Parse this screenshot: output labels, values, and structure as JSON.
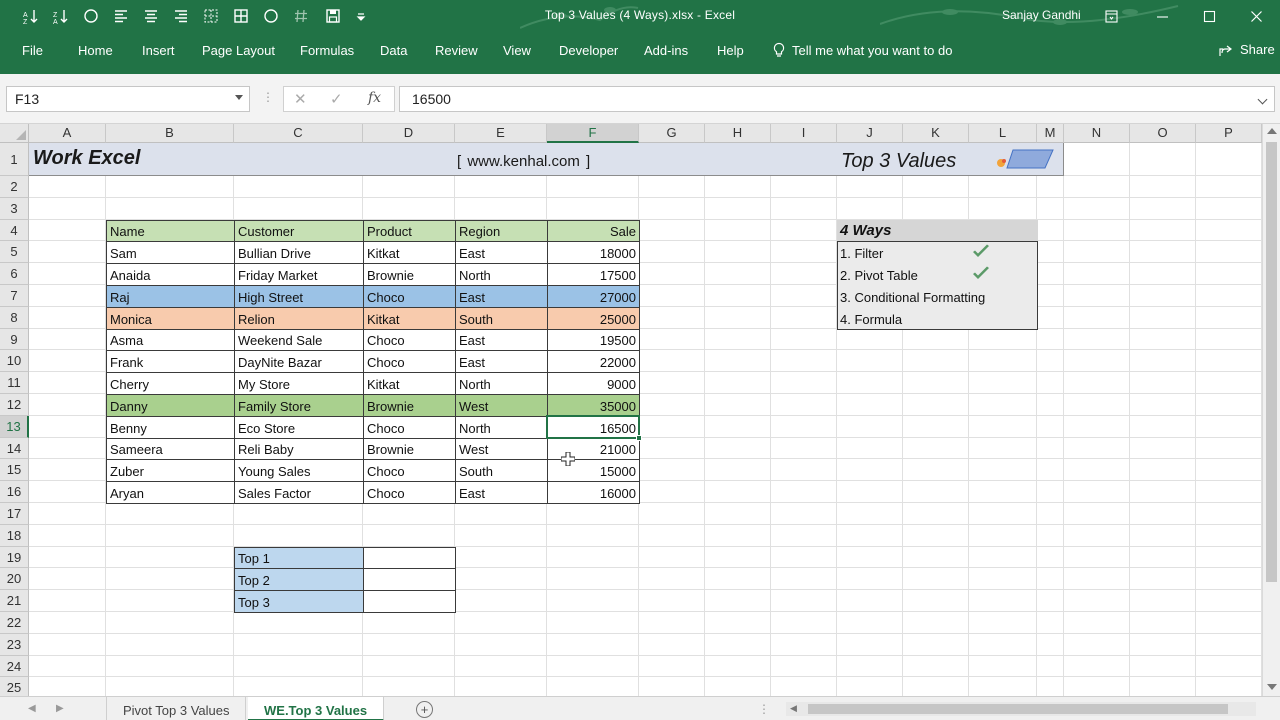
{
  "window": {
    "title": "Top 3 Values (4 Ways).xlsx  -  Excel",
    "user": "Sanjay Gandhi"
  },
  "ribbon": {
    "tabs": [
      "File",
      "Home",
      "Insert",
      "Page Layout",
      "Formulas",
      "Data",
      "Review",
      "View",
      "Developer",
      "Add-ins",
      "Help"
    ],
    "tell_me": "Tell me what you want to do",
    "share": "Share"
  },
  "qat": {
    "icons": [
      "sort-ascending-icon",
      "sort-descending-icon",
      "circle-icon",
      "align-left-icon",
      "align-center-icon",
      "align-right-icon",
      "borders-icon",
      "all-borders-icon",
      "circle-icon",
      "hash-icon",
      "save-icon",
      "customize-qat-icon"
    ]
  },
  "formula_bar": {
    "name_box": "F13",
    "cancel_icon": "✕",
    "enter_icon": "✓",
    "fx_label": "fx",
    "formula": "16500"
  },
  "grid": {
    "columns": [
      "A",
      "B",
      "C",
      "D",
      "E",
      "F",
      "G",
      "H",
      "I",
      "J",
      "K",
      "L",
      "M",
      "N",
      "O",
      "P"
    ],
    "rows": [
      "1",
      "2",
      "3",
      "4",
      "5",
      "6",
      "7",
      "8",
      "9",
      "10",
      "11",
      "12",
      "13",
      "14",
      "15",
      "16",
      "17",
      "18",
      "19",
      "20",
      "21",
      "22",
      "23",
      "24",
      "25"
    ],
    "active_column": "F",
    "active_row": "13"
  },
  "banner": {
    "left": "Work Excel",
    "url": "[  www.kenhal.com  ]",
    "right": "Top 3 Values"
  },
  "table": {
    "headers": [
      "Name",
      "Customer",
      "Product",
      "Region",
      "Sale"
    ],
    "rows": [
      {
        "name": "Sam",
        "customer": "Bullian Drive",
        "product": "Kitkat",
        "region": "East",
        "sale": "18000"
      },
      {
        "name": "Anaida",
        "customer": "Friday Market",
        "product": "Brownie",
        "region": "North",
        "sale": "17500"
      },
      {
        "name": "Raj",
        "customer": "High Street",
        "product": "Choco",
        "region": "East",
        "sale": "27000"
      },
      {
        "name": "Monica",
        "customer": "Relion",
        "product": "Kitkat",
        "region": "South",
        "sale": "25000"
      },
      {
        "name": "Asma",
        "customer": "Weekend Sale",
        "product": "Choco",
        "region": "East",
        "sale": "19500"
      },
      {
        "name": "Frank",
        "customer": "DayNite Bazar",
        "product": "Choco",
        "region": "East",
        "sale": "22000"
      },
      {
        "name": "Cherry",
        "customer": "My Store",
        "product": "Kitkat",
        "region": "North",
        "sale": "9000"
      },
      {
        "name": "Danny",
        "customer": "Family Store",
        "product": "Brownie",
        "region": "West",
        "sale": "35000"
      },
      {
        "name": "Benny",
        "customer": "Eco Store",
        "product": "Choco",
        "region": "North",
        "sale": "16500"
      },
      {
        "name": "Sameera",
        "customer": "Reli Baby",
        "product": "Brownie",
        "region": "West",
        "sale": "21000"
      },
      {
        "name": "Zuber",
        "customer": "Young Sales",
        "product": "Choco",
        "region": "South",
        "sale": "15000"
      },
      {
        "name": "Aryan",
        "customer": "Sales Factor",
        "product": "Choco",
        "region": "East",
        "sale": "16000"
      }
    ],
    "highlight_colors": {
      "header": "#c6e0b4",
      "blue": "#9bc2e6",
      "orange": "#f8cbad",
      "green": "#a9d08e"
    }
  },
  "top3": {
    "labels": [
      "Top 1",
      "Top 2",
      "Top 3"
    ],
    "label_color": "#bdd7ee"
  },
  "ways": {
    "title": "4 Ways",
    "items": [
      {
        "text": "1. Filter",
        "checked": true
      },
      {
        "text": "2. Pivot Table",
        "checked": true
      },
      {
        "text": "3. Conditional Formatting",
        "checked": false
      },
      {
        "text": "4. Formula",
        "checked": false
      }
    ],
    "check_color": "#5b9a68"
  },
  "sheets": {
    "tabs": [
      "Pivot Top 3 Values",
      "WE.Top 3 Values"
    ],
    "active_index": 1
  },
  "accent_color": "#217346"
}
